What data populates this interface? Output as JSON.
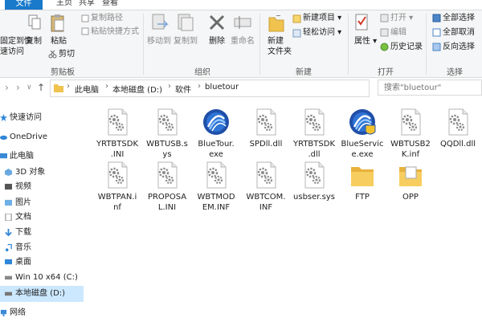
{
  "tabs": [
    "文件",
    "主页",
    "共享",
    "查看"
  ],
  "ribbon": {
    "clipboard": {
      "group_label": "剪贴板",
      "pin_label_1": "固定到快",
      "pin_label_2": "速访问",
      "copy": "复制",
      "paste": "粘贴",
      "copy_path": "复制路径",
      "paste_shortcut": "粘贴快捷方式",
      "cut": "剪切"
    },
    "organize": {
      "group_label": "组织",
      "move_to": "移动到",
      "copy_to": "复制到",
      "delete": "删除",
      "rename": "重命名"
    },
    "new": {
      "group_label": "新建",
      "new_folder_1": "新建",
      "new_folder_2": "文件夹",
      "new_item": "新建项目",
      "easy_access": "轻松访问"
    },
    "open": {
      "group_label": "打开",
      "properties": "属性",
      "open": "打开",
      "edit": "编辑",
      "history": "历史记录"
    },
    "select": {
      "group_label": "选择",
      "select_all": "全部选择",
      "select_none": "全部取消",
      "invert": "反向选择"
    }
  },
  "address": {
    "crumbs": [
      "此电脑",
      "本地磁盘 (D:)",
      "软件",
      "bluetour"
    ],
    "search_placeholder": "搜索\"bluetour\""
  },
  "sidebar": {
    "items": [
      {
        "label": "快速访问",
        "icon": "star-icon"
      },
      {
        "label": "OneDrive",
        "icon": "cloud-icon"
      },
      {
        "label": "此电脑",
        "icon": "computer-icon"
      },
      {
        "label": "3D 对象",
        "icon": "cube-icon"
      },
      {
        "label": "视频",
        "icon": "video-icon"
      },
      {
        "label": "图片",
        "icon": "picture-icon"
      },
      {
        "label": "文档",
        "icon": "document-icon"
      },
      {
        "label": "下载",
        "icon": "download-icon"
      },
      {
        "label": "音乐",
        "icon": "music-icon"
      },
      {
        "label": "桌面",
        "icon": "desktop-icon"
      },
      {
        "label": "Win 10 x64 (C:)",
        "icon": "drive-icon"
      },
      {
        "label": "本地磁盘 (D:)",
        "icon": "drive-icon"
      },
      {
        "label": "网络",
        "icon": "network-icon"
      }
    ]
  },
  "files": [
    {
      "name": "YRTBTSDK.INI",
      "line1": "YRTBTSDK",
      "line2": ".INI",
      "type": "config"
    },
    {
      "name": "WBTUSB.sys",
      "line1": "WBTUSB.s",
      "line2": "ys",
      "type": "config"
    },
    {
      "name": "BlueTour.exe",
      "line1": "BlueTour.",
      "line2": "exe",
      "type": "bluetooth"
    },
    {
      "name": "SPDll.dll",
      "line1": "SPDll.dll",
      "line2": "",
      "type": "config"
    },
    {
      "name": "YRTBTSDK.dll",
      "line1": "YRTBTSDK",
      "line2": ".dll",
      "type": "config"
    },
    {
      "name": "BlueService.exe",
      "line1": "BlueServic",
      "line2": "e.exe",
      "type": "bluetooth-shield"
    },
    {
      "name": "WBTUSB2K.inf",
      "line1": "WBTUSB2",
      "line2": "K.inf",
      "type": "config"
    },
    {
      "name": "QQDll.dll",
      "line1": "QQDll.dll",
      "line2": "",
      "type": "config"
    },
    {
      "name": "WBTPAN.inf",
      "line1": "WBTPAN.i",
      "line2": "nf",
      "type": "config"
    },
    {
      "name": "PROPOSAL.INI",
      "line1": "PROPOSA",
      "line2": "L.INI",
      "type": "config"
    },
    {
      "name": "WBTMODEM.INF",
      "line1": "WBTMOD",
      "line2": "EM.INF",
      "type": "config"
    },
    {
      "name": "WBTCOM.INF",
      "line1": "WBTCOM.",
      "line2": "INF",
      "type": "config"
    },
    {
      "name": "usbser.sys",
      "line1": "usbser.sys",
      "line2": "",
      "type": "config"
    },
    {
      "name": "FTP",
      "line1": "FTP",
      "line2": "",
      "type": "folder"
    },
    {
      "name": "OPP",
      "line1": "OPP",
      "line2": "",
      "type": "folder-doc"
    }
  ],
  "colors": {
    "accent": "#1979ca",
    "selected_bg": "#cce8ff",
    "folder": "#f0c24e"
  }
}
